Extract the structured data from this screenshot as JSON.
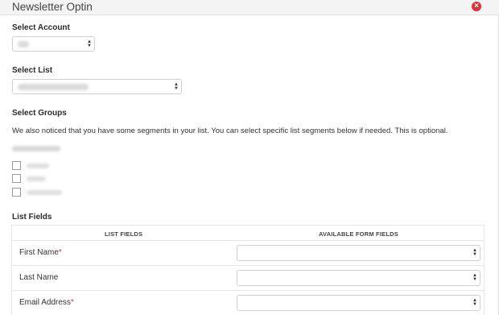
{
  "header": {
    "title": "Newsletter Optin"
  },
  "account": {
    "label": "Select Account"
  },
  "list": {
    "label": "Select List"
  },
  "groups": {
    "label": "Select Groups",
    "description": "We also noticed that you have some segments in your list. You can select specific list segments below if needed. This is optional."
  },
  "list_fields": {
    "label": "List Fields",
    "columns": [
      "LIST FIELDS",
      "AVAILABLE FORM FIELDS"
    ],
    "rows": [
      {
        "name": "First Name",
        "required": "*"
      },
      {
        "name": "Last Name",
        "required": ""
      },
      {
        "name": "Email Address",
        "required": "*"
      }
    ]
  },
  "colors": {
    "required": "#d63638",
    "close": "#d63638"
  },
  "icons": {
    "close": "close-circle-icon",
    "select": "updown-arrows-icon"
  }
}
